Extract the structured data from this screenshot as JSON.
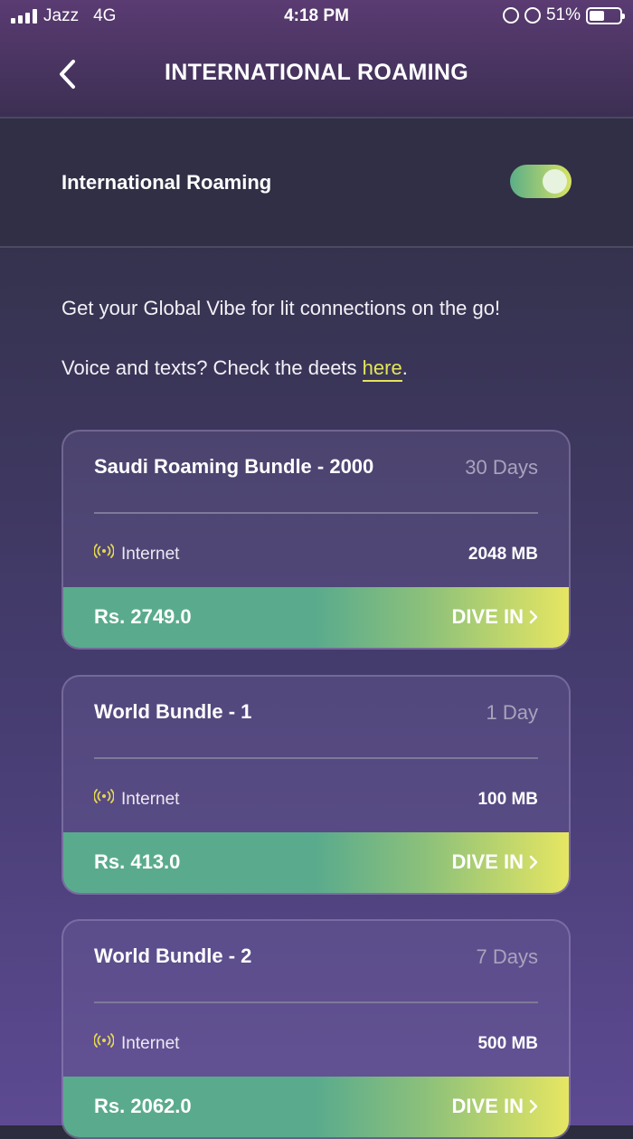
{
  "status_bar": {
    "carrier": "Jazz",
    "network": "4G",
    "time": "4:18 PM",
    "battery_percent": "51%",
    "battery_level": 0.51
  },
  "header": {
    "title": "INTERNATIONAL ROAMING",
    "back_icon": "chevron-left-icon"
  },
  "roaming_toggle": {
    "label": "International Roaming",
    "enabled": true
  },
  "intro": {
    "text": "Get your Global Vibe for lit connections on the go!",
    "deets_prefix": "Voice and texts? Check the deets ",
    "deets_link": "here",
    "deets_suffix": "."
  },
  "bundles": [
    {
      "title": "Saudi Roaming Bundle - 2000",
      "duration": "30 Days",
      "feature": "Internet",
      "amount": "2048 MB",
      "price": "Rs. 2749.0",
      "cta": "DIVE IN"
    },
    {
      "title": "World Bundle - 1",
      "duration": "1 Day",
      "feature": "Internet",
      "amount": "100 MB",
      "price": "Rs. 413.0",
      "cta": "DIVE IN"
    },
    {
      "title": "World Bundle - 2",
      "duration": "7 Days",
      "feature": "Internet",
      "amount": "500 MB",
      "price": "Rs. 2062.0",
      "cta": "DIVE IN"
    }
  ],
  "colors": {
    "accent_yellow": "#e4e45a",
    "footer_green": "#5aab8d",
    "toggle_on": "#5bae88"
  }
}
